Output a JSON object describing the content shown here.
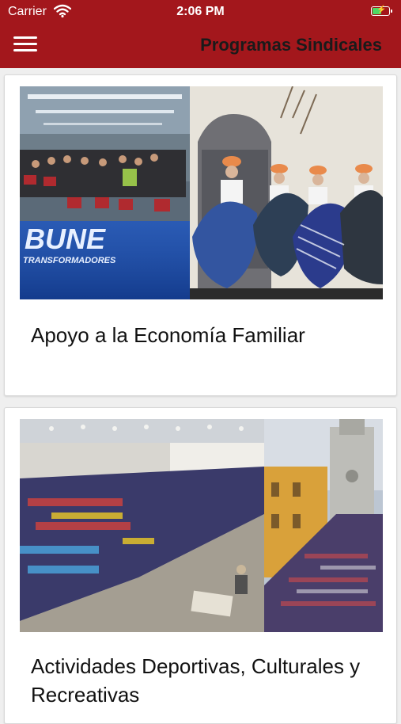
{
  "status_bar": {
    "carrier": "Carrier",
    "time": "2:06 PM",
    "battery_level": 0.6,
    "wifi_icon": "wifi-icon",
    "battery_icon": "battery-charging-icon"
  },
  "header": {
    "title": "Programas Sindicales",
    "menu_icon": "hamburger-menu-icon",
    "background_color": "#a3171c"
  },
  "cards": [
    {
      "label": "Apoyo a la Economía Familiar",
      "image": "event-collage-photo"
    },
    {
      "label": "Actividades Deportivas, Culturales y Recreativas",
      "image": "sports-event-collage-photo"
    }
  ],
  "photo_lettering": {
    "floor_logo": "BUNE",
    "floor_text": "TRANSFORMADORES"
  }
}
